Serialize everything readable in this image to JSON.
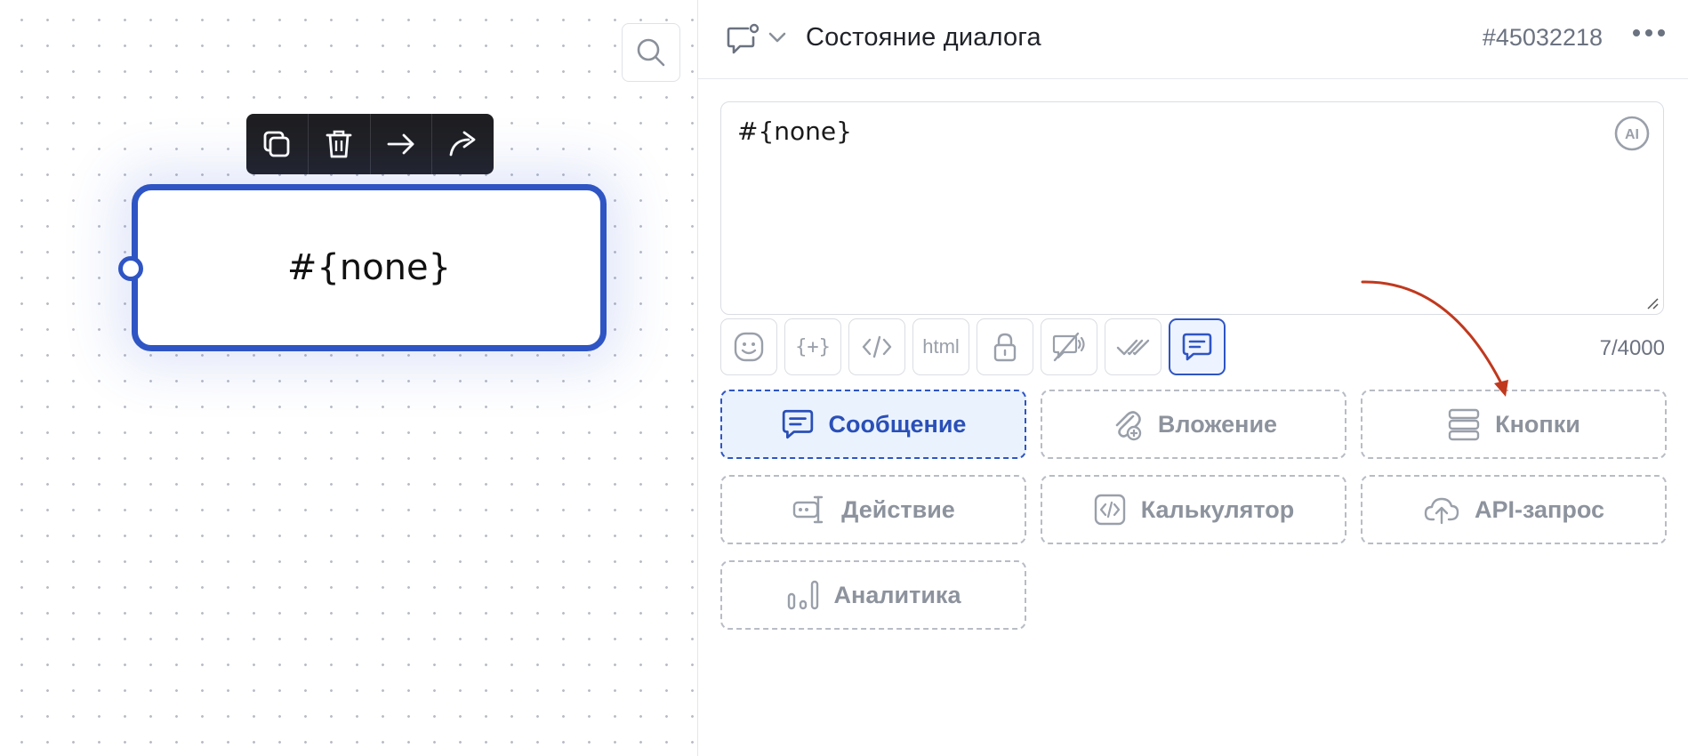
{
  "canvas": {
    "node_text": "#{none}",
    "toolbar": [
      "copy-icon",
      "trash-icon",
      "arrow-right-icon",
      "share-icon"
    ]
  },
  "header": {
    "title": "Состояние диалога",
    "id": "#45032218"
  },
  "editor": {
    "value": "#{none}",
    "ai_badge": "AI"
  },
  "format_bar": {
    "html_label": "html",
    "braces_label": "{+}",
    "char_count": "7/4000"
  },
  "blocks": [
    {
      "label": "Сообщение",
      "icon": "message-icon",
      "selected": true
    },
    {
      "label": "Вложение",
      "icon": "attachment-icon",
      "selected": false
    },
    {
      "label": "Кнопки",
      "icon": "buttons-icon",
      "selected": false
    },
    {
      "label": "Действие",
      "icon": "action-icon",
      "selected": false
    },
    {
      "label": "Калькулятор",
      "icon": "calculator-icon",
      "selected": false
    },
    {
      "label": "API-запрос",
      "icon": "cloud-upload-icon",
      "selected": false
    },
    {
      "label": "Аналитика",
      "icon": "analytics-icon",
      "selected": false
    }
  ],
  "colors": {
    "accent": "#2f55c4",
    "annotation_arrow": "#c0391e"
  }
}
